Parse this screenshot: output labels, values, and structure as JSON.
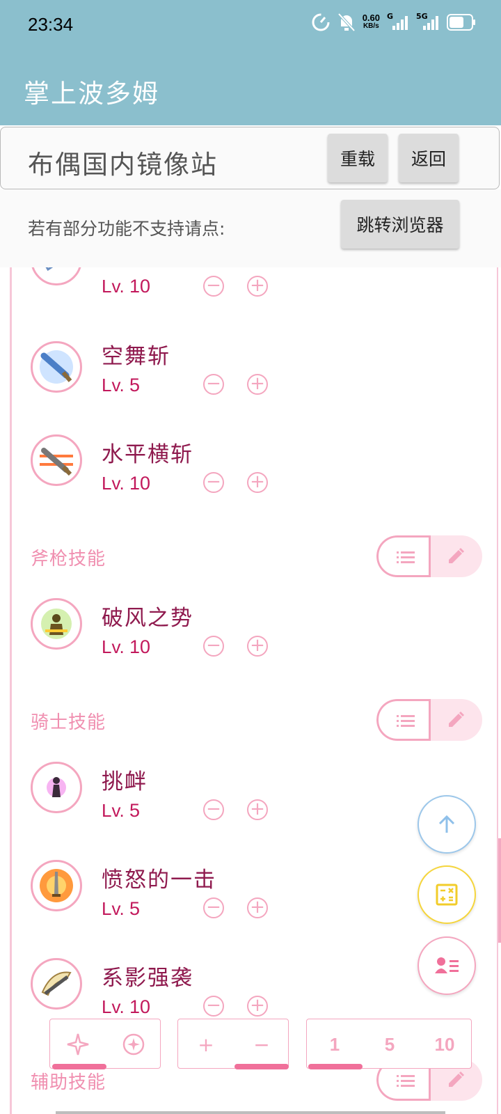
{
  "status_bar": {
    "time": "23:34",
    "net_speed": "0.60",
    "net_unit": "KB/s",
    "sim1": "G",
    "sim2": "5G"
  },
  "app": {
    "title": "掌上波多姆"
  },
  "mirror": {
    "title": "布偶国内镜像站",
    "reload_label": "重载",
    "back_label": "返回"
  },
  "notice": {
    "text": "若有部分功能不支持请点:",
    "browser_label": "跳转浏览器"
  },
  "level_prefix": "Lv.",
  "skills_top": [
    {
      "name": "",
      "level": "10"
    },
    {
      "name": "空舞斩",
      "level": "5"
    },
    {
      "name": "水平横斩",
      "level": "10"
    }
  ],
  "category_axe": {
    "label": "斧枪技能",
    "skills": [
      {
        "name": "破风之势",
        "level": "10"
      }
    ]
  },
  "category_knight": {
    "label": "骑士技能",
    "skills": [
      {
        "name": "挑衅",
        "level": "5"
      },
      {
        "name": "愤怒的一击",
        "level": "5"
      },
      {
        "name": "系影强袭",
        "level": "10"
      }
    ]
  },
  "category_support": {
    "label": "辅助技能"
  },
  "controls": {
    "increments": [
      "1",
      "5",
      "10"
    ],
    "plus": "+",
    "minus": "−"
  },
  "colors": {
    "primary": "#8bbfcd",
    "accent": "#f4a6bf",
    "text_accent": "#8f1a4e",
    "fab_blue": "#9cc7ea",
    "fab_yellow": "#f5d53c"
  }
}
